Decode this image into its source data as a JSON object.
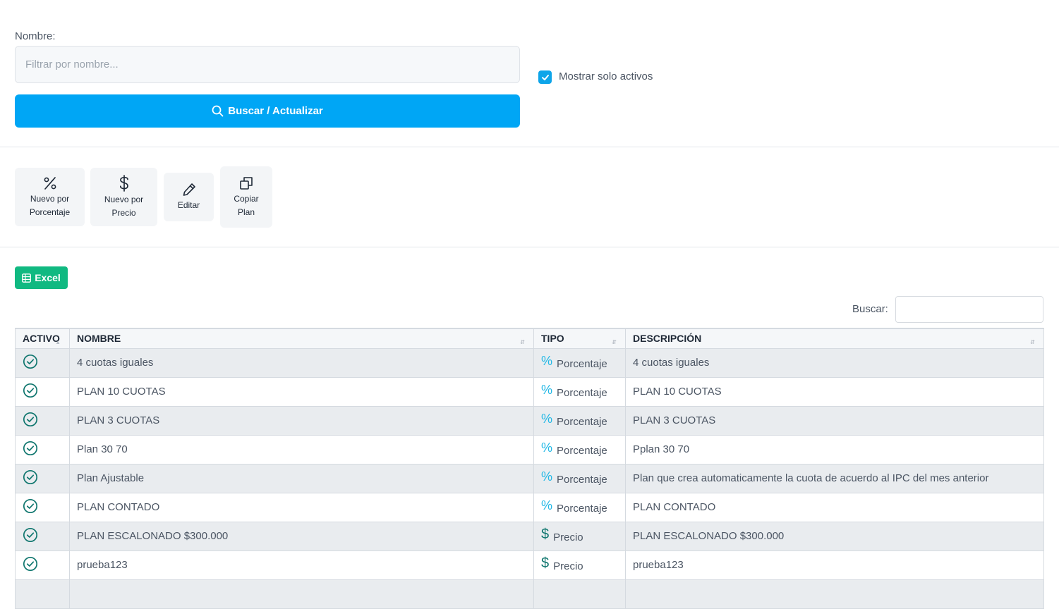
{
  "filter": {
    "name_label": "Nombre:",
    "name_placeholder": "Filtrar por nombre...",
    "name_value": "",
    "active_only_label": "Mostrar solo activos",
    "active_only_checked": true,
    "search_button_label": "Buscar / Actualizar"
  },
  "toolbar": {
    "new_percentage": {
      "line1": "Nuevo por",
      "line2": "Porcentaje",
      "icon": "percent-icon"
    },
    "new_price": {
      "line1": "Nuevo por",
      "line2": "Precio",
      "icon": "dollar-icon"
    },
    "edit": {
      "label": "Editar",
      "icon": "pencil-icon"
    },
    "copy": {
      "line1": "Copiar",
      "line2": "Plan",
      "icon": "copy-icon"
    }
  },
  "export": {
    "excel_label": "Excel"
  },
  "table_search": {
    "label": "Buscar:",
    "value": ""
  },
  "table": {
    "headers": {
      "activo": "ACTIVO",
      "nombre": "NOMBRE",
      "tipo": "TIPO",
      "descripcion": "DESCRIPCIÓN"
    },
    "rows": [
      {
        "activo": true,
        "nombre": "4 cuotas iguales",
        "tipo": "Porcentaje",
        "tipo_icon": "%",
        "descripcion": "4 cuotas iguales"
      },
      {
        "activo": true,
        "nombre": "PLAN 10 CUOTAS",
        "tipo": "Porcentaje",
        "tipo_icon": "%",
        "descripcion": "PLAN 10 CUOTAS"
      },
      {
        "activo": true,
        "nombre": "PLAN 3 CUOTAS",
        "tipo": "Porcentaje",
        "tipo_icon": "%",
        "descripcion": "PLAN 3 CUOTAS"
      },
      {
        "activo": true,
        "nombre": "Plan 30 70",
        "tipo": "Porcentaje",
        "tipo_icon": "%",
        "descripcion": "Pplan 30 70"
      },
      {
        "activo": true,
        "nombre": "Plan Ajustable",
        "tipo": "Porcentaje",
        "tipo_icon": "%",
        "descripcion": "Plan que crea automaticamente la cuota de acuerdo al IPC del mes anterior"
      },
      {
        "activo": true,
        "nombre": "PLAN CONTADO",
        "tipo": "Porcentaje",
        "tipo_icon": "%",
        "descripcion": "PLAN CONTADO"
      },
      {
        "activo": true,
        "nombre": "PLAN ESCALONADO $300.000",
        "tipo": "Precio",
        "tipo_icon": "$",
        "descripcion": "PLAN ESCALONADO $300.000"
      },
      {
        "activo": true,
        "nombre": "prueba123",
        "tipo": "Precio",
        "tipo_icon": "$",
        "descripcion": "prueba123"
      }
    ]
  },
  "colors": {
    "primary": "#00a6f5",
    "excel": "#10b981",
    "active_icon": "#0f766e",
    "percent_icon": "#22b8e6",
    "price_icon": "#0f766e"
  }
}
